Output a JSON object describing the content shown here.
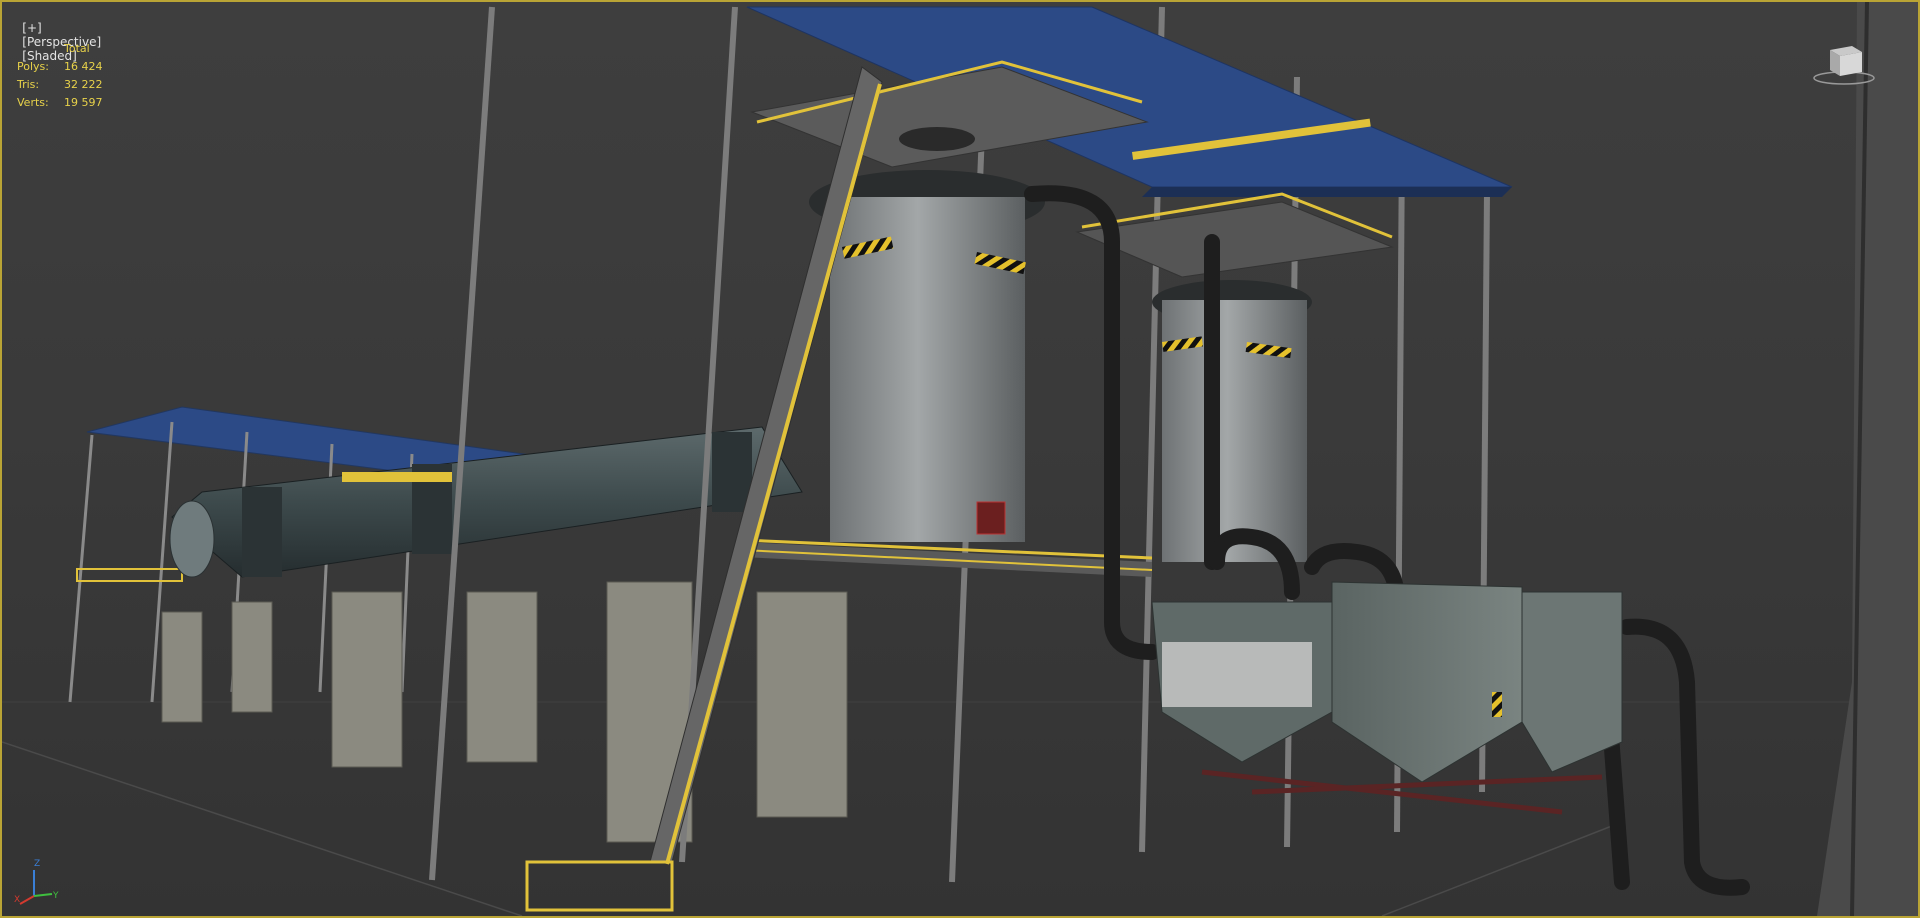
{
  "viewport": {
    "menu_plus": "[+]",
    "view_name": "[Perspective]",
    "shading_mode": "[Shaded]",
    "border_color": "#b9a435",
    "background_color": "#3b3b3b"
  },
  "stats": {
    "header": "Total",
    "rows": [
      {
        "label": "Polys:",
        "value": "16 424"
      },
      {
        "label": "Tris:",
        "value": "32 222"
      },
      {
        "label": "Verts:",
        "value": "19 597"
      }
    ],
    "text_color": "#e8d24a"
  },
  "viewcube": {
    "icon": "viewcube-icon"
  },
  "axis_tripod": {
    "x_label": "X",
    "y_label": "Y",
    "z_label": "Z",
    "x_color": "#d33a2f",
    "y_color": "#3fbf3f",
    "z_color": "#3a7fd6"
  },
  "scene": {
    "description_icon": "industrial-plant-3d-model",
    "colors": {
      "roof": "#2c4a86",
      "concrete": "#8b8a80",
      "railing": "#e1c23a",
      "pipe": "#1f1f1f",
      "tank": "#8f9496",
      "kiln": "#3a4547"
    }
  }
}
